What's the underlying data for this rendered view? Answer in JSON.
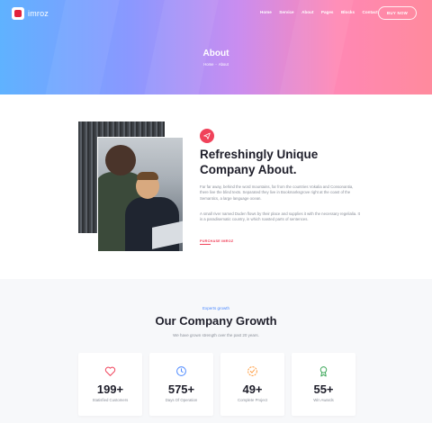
{
  "header": {
    "logo_text": "imroz",
    "nav": [
      "Home",
      "Service",
      "About",
      "Pages",
      "Blocks",
      "Contact"
    ],
    "cta_label": "BUY NOW"
  },
  "hero": {
    "title": "About",
    "breadcrumb": [
      "Home",
      "About"
    ],
    "breadcrumb_sep": "-"
  },
  "about": {
    "icon": "send-icon",
    "title": "Refreshingly Unique Company About.",
    "paragraph1": "Far far away, behind the word mountains, far from the countries Vokalia and Consonantia, there live the blind texts. Separated they live in Bookmarksgrove right at the coast of the Semantics, a large language ocean.",
    "paragraph2": "A small river named Duden flows by their place and supplies it with the necessary regelialia. It is a paradisematic country, in which roasted parts of sentences.",
    "link_label": "PURCHASE IMROZ"
  },
  "growth": {
    "kicker": "Experts growth",
    "title": "Our Company Growth",
    "subtitle": "We have grown strength over the past 20 years.",
    "stats": [
      {
        "icon": "heart-icon",
        "color": "#f0425a",
        "value": "199+",
        "label": "Statisfied Customers"
      },
      {
        "icon": "clock-icon",
        "color": "#4f8bff",
        "value": "575+",
        "label": "Days Of Operation"
      },
      {
        "icon": "check-badge-icon",
        "color": "#ff9a3c",
        "value": "49+",
        "label": "Complete Project"
      },
      {
        "icon": "award-icon",
        "color": "#3aa657",
        "value": "55+",
        "label": "Win Awards"
      }
    ]
  },
  "colors": {
    "accent": "#f0425a",
    "blue": "#4f8bff",
    "heading": "#1e1e2a"
  }
}
